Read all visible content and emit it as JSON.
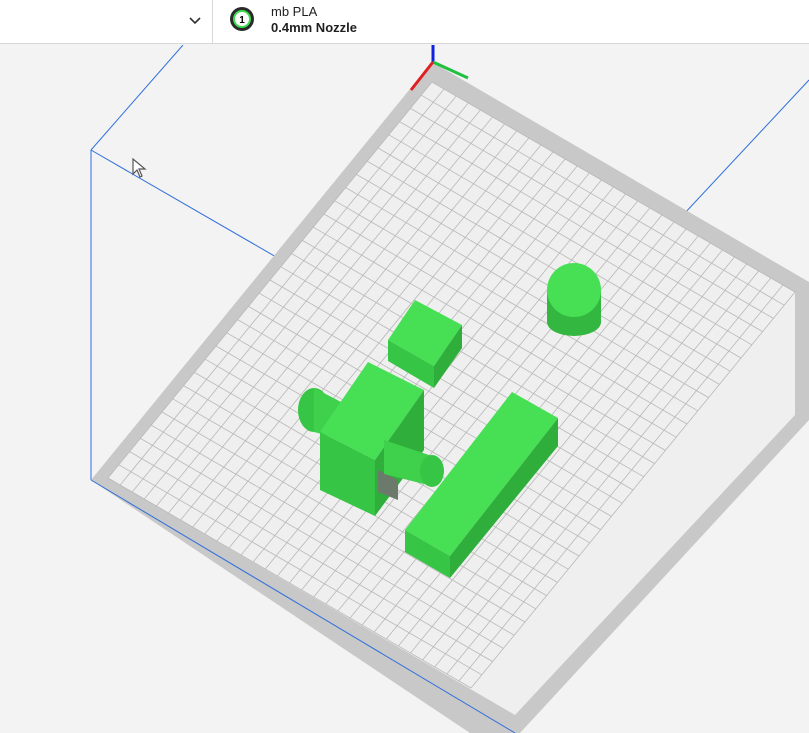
{
  "header": {
    "material": "mb PLA",
    "nozzle": "0.4mm Nozzle",
    "extruder_number": "1"
  },
  "icons": {
    "dropdown": "chevron-down-icon",
    "extruder": "extruder-badge-icon",
    "cursor": "mouse-pointer-icon"
  },
  "colors": {
    "model_green": "#3fdc4e",
    "bed_grid": "#e9e9e9",
    "bed_border": "#c8c8c8",
    "volume_lines": "#2f6fdc",
    "axis_x": "#e02020",
    "axis_y": "#20c040",
    "axis_z": "#1020e0"
  }
}
